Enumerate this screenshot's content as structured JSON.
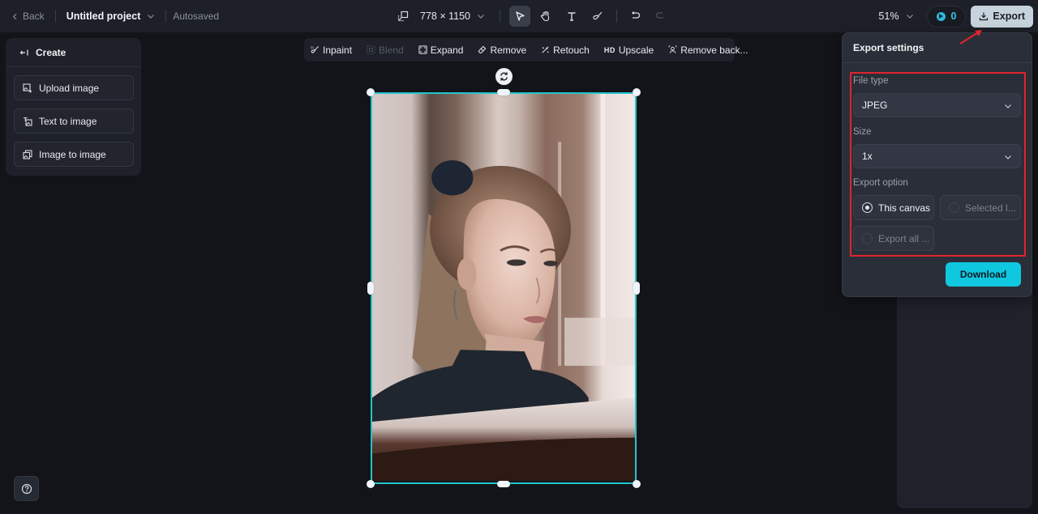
{
  "topbar": {
    "back_label": "Back",
    "project_title": "Untitled project",
    "save_status": "Autosaved",
    "canvas_dimensions": "778 × 1150",
    "zoom_level": "51%",
    "credits": "0",
    "export_label": "Export",
    "tools": [
      {
        "name": "select",
        "active": true
      },
      {
        "name": "hand",
        "active": false
      },
      {
        "name": "text",
        "active": false
      },
      {
        "name": "brush",
        "active": false
      },
      {
        "name": "undo",
        "active": false
      },
      {
        "name": "redo",
        "active": false
      }
    ]
  },
  "create_panel": {
    "title": "Create",
    "items": [
      {
        "label": "Upload image",
        "icon": "upload-image-icon"
      },
      {
        "label": "Text to image",
        "icon": "text-to-image-icon"
      },
      {
        "label": "Image to image",
        "icon": "image-to-image-icon"
      }
    ]
  },
  "edit_toolbar": {
    "items": [
      {
        "label": "Inpaint",
        "icon": "inpaint-icon",
        "enabled": true
      },
      {
        "label": "Blend",
        "icon": "blend-icon",
        "enabled": false
      },
      {
        "label": "Expand",
        "icon": "expand-icon",
        "enabled": true
      },
      {
        "label": "Remove",
        "icon": "eraser-icon",
        "enabled": true
      },
      {
        "label": "Retouch",
        "icon": "retouch-icon",
        "enabled": true
      },
      {
        "label": "Upscale",
        "icon": "hd-icon",
        "icon_text": "HD",
        "enabled": true
      },
      {
        "label": "Remove back...",
        "icon": "remove-background-icon",
        "enabled": true
      }
    ]
  },
  "canvas": {
    "image_description": "Portrait photo of a young woman with ponytail and dark scrunchie, wearing black turtleneck, looking toward a window",
    "selection_color": "#25c4cc"
  },
  "export_settings": {
    "title": "Export settings",
    "file_type_label": "File type",
    "file_type_value": "JPEG",
    "size_label": "Size",
    "size_value": "1x",
    "export_option_label": "Export option",
    "options": [
      {
        "label": "This canvas",
        "selected": true,
        "enabled": true
      },
      {
        "label": "Selected l...",
        "selected": false,
        "enabled": false
      },
      {
        "label": "Export all ...",
        "selected": false,
        "enabled": false
      }
    ],
    "download_label": "Download",
    "accent_color": "#10c7e0",
    "highlight_color": "#e0242c"
  }
}
